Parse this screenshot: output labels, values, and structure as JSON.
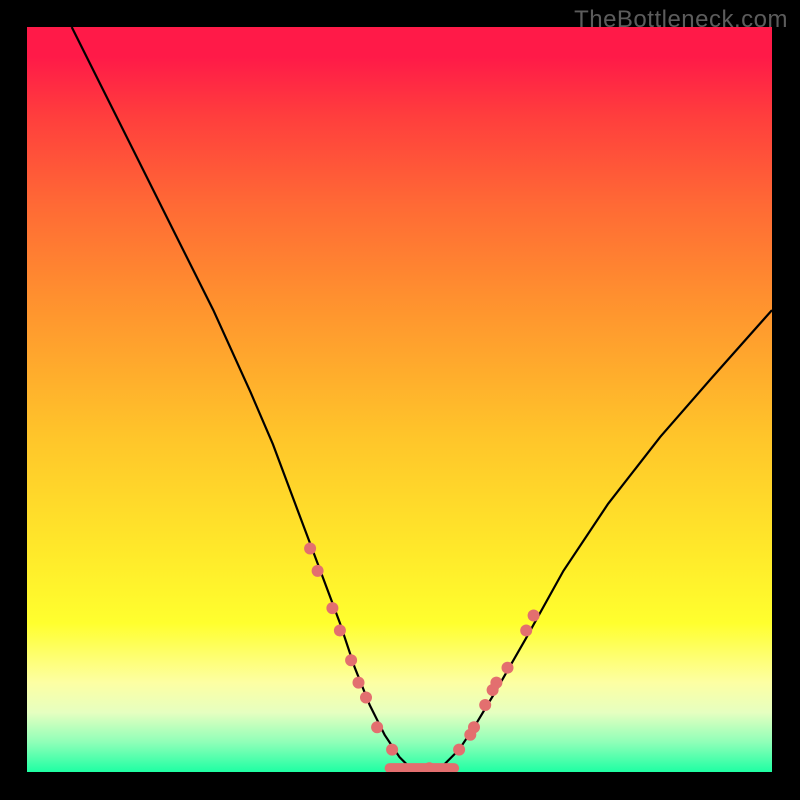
{
  "watermark": "TheBottleneck.com",
  "colors": {
    "dot": "#e36f6f",
    "line": "#000000",
    "background_top": "#ff1a48",
    "background_bottom": "#1effa3",
    "frame": "#000000"
  },
  "chart_data": {
    "type": "line",
    "title": "",
    "xlabel": "",
    "ylabel": "",
    "xlim": [
      0,
      100
    ],
    "ylim": [
      0,
      100
    ],
    "grid": false,
    "series": [
      {
        "name": "bottleneck-curve",
        "x": [
          6,
          10,
          15,
          20,
          25,
          30,
          33,
          36,
          39,
          42,
          44,
          46,
          48,
          50,
          52,
          54,
          56,
          58,
          60,
          63,
          67,
          72,
          78,
          85,
          92,
          100
        ],
        "y": [
          100,
          92,
          82,
          72,
          62,
          51,
          44,
          36,
          28,
          20,
          14,
          9,
          5,
          2,
          0,
          0,
          1,
          3,
          6,
          11,
          18,
          27,
          36,
          45,
          53,
          62
        ]
      }
    ],
    "markers": {
      "name": "highlight-points",
      "points": [
        {
          "x": 38,
          "y": 30
        },
        {
          "x": 39,
          "y": 27
        },
        {
          "x": 41,
          "y": 22
        },
        {
          "x": 42,
          "y": 19
        },
        {
          "x": 43.5,
          "y": 15
        },
        {
          "x": 44.5,
          "y": 12
        },
        {
          "x": 45.5,
          "y": 10
        },
        {
          "x": 47,
          "y": 6
        },
        {
          "x": 49,
          "y": 3
        },
        {
          "x": 54,
          "y": 0.5
        },
        {
          "x": 58,
          "y": 3
        },
        {
          "x": 59.5,
          "y": 5
        },
        {
          "x": 60,
          "y": 6
        },
        {
          "x": 61.5,
          "y": 9
        },
        {
          "x": 62.5,
          "y": 11
        },
        {
          "x": 63,
          "y": 12
        },
        {
          "x": 64.5,
          "y": 14
        },
        {
          "x": 67,
          "y": 19
        },
        {
          "x": 68,
          "y": 21
        }
      ],
      "radius": 6,
      "color": "#e36f6f"
    },
    "bottom_fill": {
      "y_from": 0,
      "y_to": 1.2,
      "x_from": 48,
      "x_to": 58,
      "color": "#e36f6f"
    }
  }
}
